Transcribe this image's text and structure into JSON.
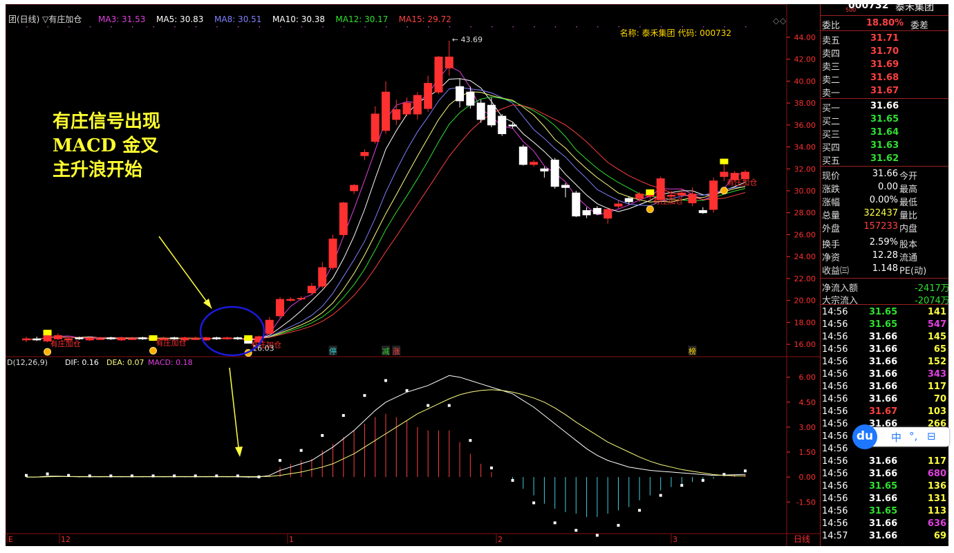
{
  "header": {
    "title": "团(日线) ▽有庄加仓",
    "ma_labels": [
      {
        "text": "MA3: 31.53",
        "color": "#e040e0"
      },
      {
        "text": "MA5: 30.83",
        "color": "#ffffff"
      },
      {
        "text": "MA8: 30.51",
        "color": "#8080ff"
      },
      {
        "text": "MA10: 30.38",
        "color": "#ffffff"
      },
      {
        "text": "MA12: 30.17",
        "color": "#30e030"
      },
      {
        "text": "MA15: 29.72",
        "color": "#ff4040"
      }
    ],
    "info": "名称: 泰禾集团 代码: 000732"
  },
  "annotations": {
    "lines": [
      "有庄信号出现",
      "MACD 金叉",
      "主升浪开始"
    ],
    "signal_label": "有庄加仓",
    "high_label": "43.69",
    "low_label": "16.03",
    "badges": [
      "停",
      "减",
      "涨",
      "榜"
    ]
  },
  "macd_header": {
    "name": "D(12,26,9)",
    "dif": "DIF: 0.16",
    "dea": "DEA: 0.07",
    "macd": "MACD: 0.18"
  },
  "x_axis": {
    "labels": [
      "E",
      "12",
      "1",
      "2",
      "3"
    ],
    "period": "日线"
  },
  "colors": {
    "up": "#ff3030",
    "down": "#ffffff",
    "grid": "#8b1010",
    "axis_text": "#ff3030",
    "annotation": "#ffff30"
  },
  "chart_data": [
    {
      "type": "candlestick",
      "title": "",
      "y_axis": {
        "min": 15,
        "max": 45,
        "ticks": [
          16,
          18,
          20,
          22,
          24,
          26,
          28,
          30,
          32,
          34,
          36,
          38,
          40,
          42,
          44
        ]
      },
      "candles": [
        {
          "o": 16.4,
          "h": 16.7,
          "l": 16.2,
          "c": 16.5
        },
        {
          "o": 16.5,
          "h": 16.7,
          "l": 16.3,
          "c": 16.4
        },
        {
          "o": 16.3,
          "h": 17.2,
          "l": 16.2,
          "c": 17.0
        },
        {
          "o": 16.5,
          "h": 17.0,
          "l": 16.4,
          "c": 16.8
        },
        {
          "o": 16.4,
          "h": 16.7,
          "l": 16.3,
          "c": 16.5
        },
        {
          "o": 16.6,
          "h": 16.7,
          "l": 16.4,
          "c": 16.5
        },
        {
          "o": 16.4,
          "h": 16.7,
          "l": 16.3,
          "c": 16.6
        },
        {
          "o": 16.5,
          "h": 16.7,
          "l": 16.4,
          "c": 16.5
        },
        {
          "o": 16.6,
          "h": 16.7,
          "l": 16.4,
          "c": 16.5
        },
        {
          "o": 16.4,
          "h": 16.7,
          "l": 16.3,
          "c": 16.6
        },
        {
          "o": 16.5,
          "h": 16.7,
          "l": 16.4,
          "c": 16.5
        },
        {
          "o": 16.6,
          "h": 16.7,
          "l": 16.4,
          "c": 16.5
        },
        {
          "o": 16.4,
          "h": 16.7,
          "l": 16.3,
          "c": 16.6
        },
        {
          "o": 16.5,
          "h": 16.7,
          "l": 16.4,
          "c": 16.5
        },
        {
          "o": 16.6,
          "h": 16.7,
          "l": 16.4,
          "c": 16.5
        },
        {
          "o": 16.4,
          "h": 16.7,
          "l": 16.3,
          "c": 16.6
        },
        {
          "o": 16.5,
          "h": 16.7,
          "l": 16.4,
          "c": 16.5
        },
        {
          "o": 16.4,
          "h": 16.7,
          "l": 16.3,
          "c": 16.6
        },
        {
          "o": 16.6,
          "h": 16.7,
          "l": 16.4,
          "c": 16.5
        },
        {
          "o": 16.5,
          "h": 16.7,
          "l": 16.4,
          "c": 16.6
        },
        {
          "o": 16.6,
          "h": 16.7,
          "l": 16.4,
          "c": 16.5
        },
        {
          "o": 16.6,
          "h": 16.7,
          "l": 16.1,
          "c": 16.1
        },
        {
          "o": 16.2,
          "h": 16.8,
          "l": 16.0,
          "c": 16.7
        },
        {
          "o": 17.0,
          "h": 18.5,
          "l": 16.9,
          "c": 18.2
        },
        {
          "o": 18.6,
          "h": 20.3,
          "l": 18.4,
          "c": 20.1
        },
        {
          "o": 20.0,
          "h": 20.3,
          "l": 19.9,
          "c": 20.1
        },
        {
          "o": 20.2,
          "h": 20.4,
          "l": 20.0,
          "c": 20.2
        },
        {
          "o": 20.7,
          "h": 21.6,
          "l": 20.5,
          "c": 21.3
        },
        {
          "o": 21.3,
          "h": 23.5,
          "l": 21.1,
          "c": 23.0
        },
        {
          "o": 23.0,
          "h": 26.0,
          "l": 22.8,
          "c": 25.6
        },
        {
          "o": 26.0,
          "h": 29.0,
          "l": 25.8,
          "c": 28.9
        },
        {
          "o": 30.0,
          "h": 30.6,
          "l": 29.7,
          "c": 30.5
        },
        {
          "o": 33.2,
          "h": 33.8,
          "l": 32.8,
          "c": 33.5
        },
        {
          "o": 34.5,
          "h": 37.7,
          "l": 34.3,
          "c": 37.0
        },
        {
          "o": 35.5,
          "h": 40.0,
          "l": 35.2,
          "c": 39.0
        },
        {
          "o": 36.5,
          "h": 38.3,
          "l": 36.0,
          "c": 37.4
        },
        {
          "o": 37.0,
          "h": 38.5,
          "l": 36.8,
          "c": 38.0
        },
        {
          "o": 37.0,
          "h": 39.0,
          "l": 36.5,
          "c": 38.7
        },
        {
          "o": 37.5,
          "h": 40.5,
          "l": 37.2,
          "c": 39.8
        },
        {
          "o": 39.0,
          "h": 42.3,
          "l": 38.8,
          "c": 42.2
        },
        {
          "o": 41.2,
          "h": 43.69,
          "l": 40.5,
          "c": 42.2
        },
        {
          "o": 39.5,
          "h": 40.2,
          "l": 37.6,
          "c": 38.2
        },
        {
          "o": 39.0,
          "h": 39.5,
          "l": 37.5,
          "c": 37.8
        },
        {
          "o": 38.0,
          "h": 38.3,
          "l": 36.2,
          "c": 36.5
        },
        {
          "o": 37.8,
          "h": 38.5,
          "l": 35.8,
          "c": 36.0
        },
        {
          "o": 36.8,
          "h": 37.0,
          "l": 35.0,
          "c": 35.2
        },
        {
          "o": 36.0,
          "h": 36.2,
          "l": 35.7,
          "c": 35.9
        },
        {
          "o": 34.0,
          "h": 34.2,
          "l": 32.3,
          "c": 32.4
        },
        {
          "o": 32.4,
          "h": 32.8,
          "l": 32.2,
          "c": 32.6
        },
        {
          "o": 32.0,
          "h": 32.2,
          "l": 31.2,
          "c": 31.8
        },
        {
          "o": 32.8,
          "h": 33.0,
          "l": 30.2,
          "c": 30.4
        },
        {
          "o": 30.5,
          "h": 30.7,
          "l": 29.4,
          "c": 30.3
        },
        {
          "o": 29.8,
          "h": 30.0,
          "l": 27.6,
          "c": 27.7
        },
        {
          "o": 28.2,
          "h": 28.5,
          "l": 27.5,
          "c": 27.8
        },
        {
          "o": 28.4,
          "h": 28.6,
          "l": 27.8,
          "c": 27.9
        },
        {
          "o": 27.5,
          "h": 28.5,
          "l": 27.0,
          "c": 28.3
        },
        {
          "o": 28.6,
          "h": 29.1,
          "l": 28.4,
          "c": 28.8
        },
        {
          "o": 29.3,
          "h": 29.5,
          "l": 28.8,
          "c": 29.0
        },
        {
          "o": 29.3,
          "h": 29.9,
          "l": 29.0,
          "c": 29.7
        },
        {
          "o": 29.5,
          "h": 30.0,
          "l": 29.2,
          "c": 29.8
        },
        {
          "o": 29.2,
          "h": 31.3,
          "l": 29.0,
          "c": 31.1
        },
        {
          "o": 29.5,
          "h": 30.0,
          "l": 29.2,
          "c": 29.6
        },
        {
          "o": 29.6,
          "h": 30.2,
          "l": 29.3,
          "c": 29.8
        },
        {
          "o": 28.9,
          "h": 30.3,
          "l": 28.6,
          "c": 29.7
        },
        {
          "o": 28.2,
          "h": 28.5,
          "l": 27.9,
          "c": 28.0
        },
        {
          "o": 28.3,
          "h": 31.2,
          "l": 28.0,
          "c": 30.9
        },
        {
          "o": 31.3,
          "h": 32.8,
          "l": 30.9,
          "c": 31.7
        },
        {
          "o": 31.0,
          "h": 31.8,
          "l": 30.8,
          "c": 31.6
        },
        {
          "o": 31.1,
          "h": 31.9,
          "l": 30.8,
          "c": 31.7
        }
      ],
      "ma_series": [
        {
          "name": "MA3",
          "period": 3,
          "color": "#e040e0"
        },
        {
          "name": "MA5",
          "period": 5,
          "color": "#ffffff"
        },
        {
          "name": "MA8",
          "period": 8,
          "color": "#8080ff"
        },
        {
          "name": "MA10",
          "period": 10,
          "color": "#ffff80"
        },
        {
          "name": "MA12",
          "period": 12,
          "color": "#30e030"
        },
        {
          "name": "MA15",
          "period": 15,
          "color": "#ff4040"
        }
      ]
    },
    {
      "type": "bar",
      "title": "",
      "y_axis": {
        "min": -3.4,
        "max": 6.9,
        "ticks": [
          -1.5,
          0.0,
          1.5,
          3.0,
          4.5,
          6.0
        ]
      },
      "tick_labels": [
        "-1.50",
        "0.00",
        "1.50",
        "3.00",
        "4.50",
        "6.00"
      ],
      "series": [
        {
          "name": "DIF",
          "values": [
            0.0,
            0.0,
            0.05,
            0.05,
            0.03,
            0.02,
            0.02,
            0.02,
            0.02,
            0.02,
            0.02,
            0.02,
            0.02,
            0.02,
            0.02,
            0.02,
            0.02,
            0.02,
            0.02,
            0.02,
            0.02,
            0.0,
            0.0,
            0.1,
            0.4,
            0.6,
            0.8,
            1.0,
            1.4,
            1.8,
            2.3,
            2.8,
            3.4,
            4.0,
            4.5,
            4.8,
            5.1,
            5.3,
            5.5,
            5.8,
            6.1,
            6.0,
            5.8,
            5.6,
            5.4,
            5.2,
            5.0,
            4.6,
            4.2,
            3.7,
            3.2,
            2.7,
            2.2,
            1.7,
            1.3,
            1.0,
            0.8,
            0.6,
            0.5,
            0.4,
            0.35,
            0.3,
            0.25,
            0.2,
            0.15,
            0.1,
            0.12,
            0.14,
            0.16
          ]
        },
        {
          "name": "DEA",
          "values": [
            0.0,
            0.0,
            0.02,
            0.03,
            0.03,
            0.03,
            0.03,
            0.03,
            0.03,
            0.03,
            0.03,
            0.03,
            0.03,
            0.03,
            0.03,
            0.03,
            0.03,
            0.03,
            0.03,
            0.03,
            0.03,
            0.03,
            0.03,
            0.04,
            0.1,
            0.2,
            0.3,
            0.45,
            0.6,
            0.8,
            1.1,
            1.4,
            1.8,
            2.2,
            2.6,
            3.0,
            3.4,
            3.8,
            4.1,
            4.4,
            4.7,
            4.95,
            5.1,
            5.2,
            5.25,
            5.2,
            5.1,
            4.95,
            4.75,
            4.5,
            4.15,
            3.75,
            3.3,
            2.9,
            2.5,
            2.1,
            1.8,
            1.5,
            1.2,
            0.95,
            0.75,
            0.6,
            0.45,
            0.35,
            0.25,
            0.15,
            0.1,
            0.08,
            0.07
          ]
        }
      ]
    }
  ],
  "quote": {
    "code": "000732",
    "name": "泰禾集团",
    "level": "500",
    "wei_bi_label": "委比",
    "wei_bi": "18.80%",
    "wei_cha_label": "委差",
    "asks": [
      {
        "label": "卖五",
        "price": "31.71"
      },
      {
        "label": "卖四",
        "price": "31.70"
      },
      {
        "label": "卖三",
        "price": "31.69"
      },
      {
        "label": "卖二",
        "price": "31.68"
      },
      {
        "label": "卖一",
        "price": "31.67"
      }
    ],
    "bids": [
      {
        "label": "买一",
        "price": "31.66"
      },
      {
        "label": "买二",
        "price": "31.65"
      },
      {
        "label": "买三",
        "price": "31.64"
      },
      {
        "label": "买四",
        "price": "31.63"
      },
      {
        "label": "买五",
        "price": "31.62"
      }
    ],
    "stats": [
      {
        "k1": "现价",
        "v1": "31.66",
        "k2": "今开",
        "c": "#ffffff"
      },
      {
        "k1": "涨跌",
        "v1": "0.00",
        "k2": "最高",
        "c": "#ffffff"
      },
      {
        "k1": "涨幅",
        "v1": "0.00%",
        "k2": "最低",
        "c": "#ffffff"
      },
      {
        "k1": "总量",
        "v1": "322437",
        "k2": "量比",
        "c": "#ffff40"
      },
      {
        "k1": "外盘",
        "v1": "157233",
        "k2": "内盘",
        "c": "#ff4040"
      },
      {
        "k1": "换手",
        "v1": "2.59%",
        "k2": "股本",
        "c": "#ffffff"
      },
      {
        "k1": "净资",
        "v1": "12.28",
        "k2": "流通",
        "c": "#ffffff"
      },
      {
        "k1": "收益㈢",
        "v1": "1.148",
        "k2": "PE(动)",
        "c": "#ffffff"
      }
    ],
    "flows": [
      {
        "label": "净流入额",
        "value": "-2417万"
      },
      {
        "label": "大宗流入",
        "value": "-2074万"
      }
    ],
    "ticks": [
      {
        "t": "14:56",
        "p": "31.65",
        "v": "141"
      },
      {
        "t": "14:56",
        "p": "31.65",
        "v": "547"
      },
      {
        "t": "14:56",
        "p": "31.66",
        "v": "145"
      },
      {
        "t": "14:56",
        "p": "31.66",
        "v": "65"
      },
      {
        "t": "14:56",
        "p": "31.66",
        "v": "152"
      },
      {
        "t": "14:56",
        "p": "31.66",
        "v": "343"
      },
      {
        "t": "14:56",
        "p": "31.66",
        "v": "117"
      },
      {
        "t": "14:56",
        "p": "31.66",
        "v": "70"
      },
      {
        "t": "14:56",
        "p": "31.67",
        "v": "103"
      },
      {
        "t": "14:56",
        "p": "31.66",
        "v": "266"
      },
      {
        "t": "14:56",
        "p": "",
        "v": ""
      },
      {
        "t": "14:56",
        "p": "",
        "v": ""
      },
      {
        "t": "14:56",
        "p": "31.66",
        "v": "117"
      },
      {
        "t": "14:56",
        "p": "31.66",
        "v": "680"
      },
      {
        "t": "14:56",
        "p": "31.65",
        "v": "136"
      },
      {
        "t": "14:56",
        "p": "31.66",
        "v": "131"
      },
      {
        "t": "14:56",
        "p": "31.65",
        "v": "113"
      },
      {
        "t": "14:56",
        "p": "31.66",
        "v": "636"
      },
      {
        "t": "14:57",
        "p": "31.66",
        "v": "69"
      }
    ]
  },
  "widget": {
    "logo": "du",
    "items": [
      "中",
      "°,",
      "⊟"
    ]
  }
}
